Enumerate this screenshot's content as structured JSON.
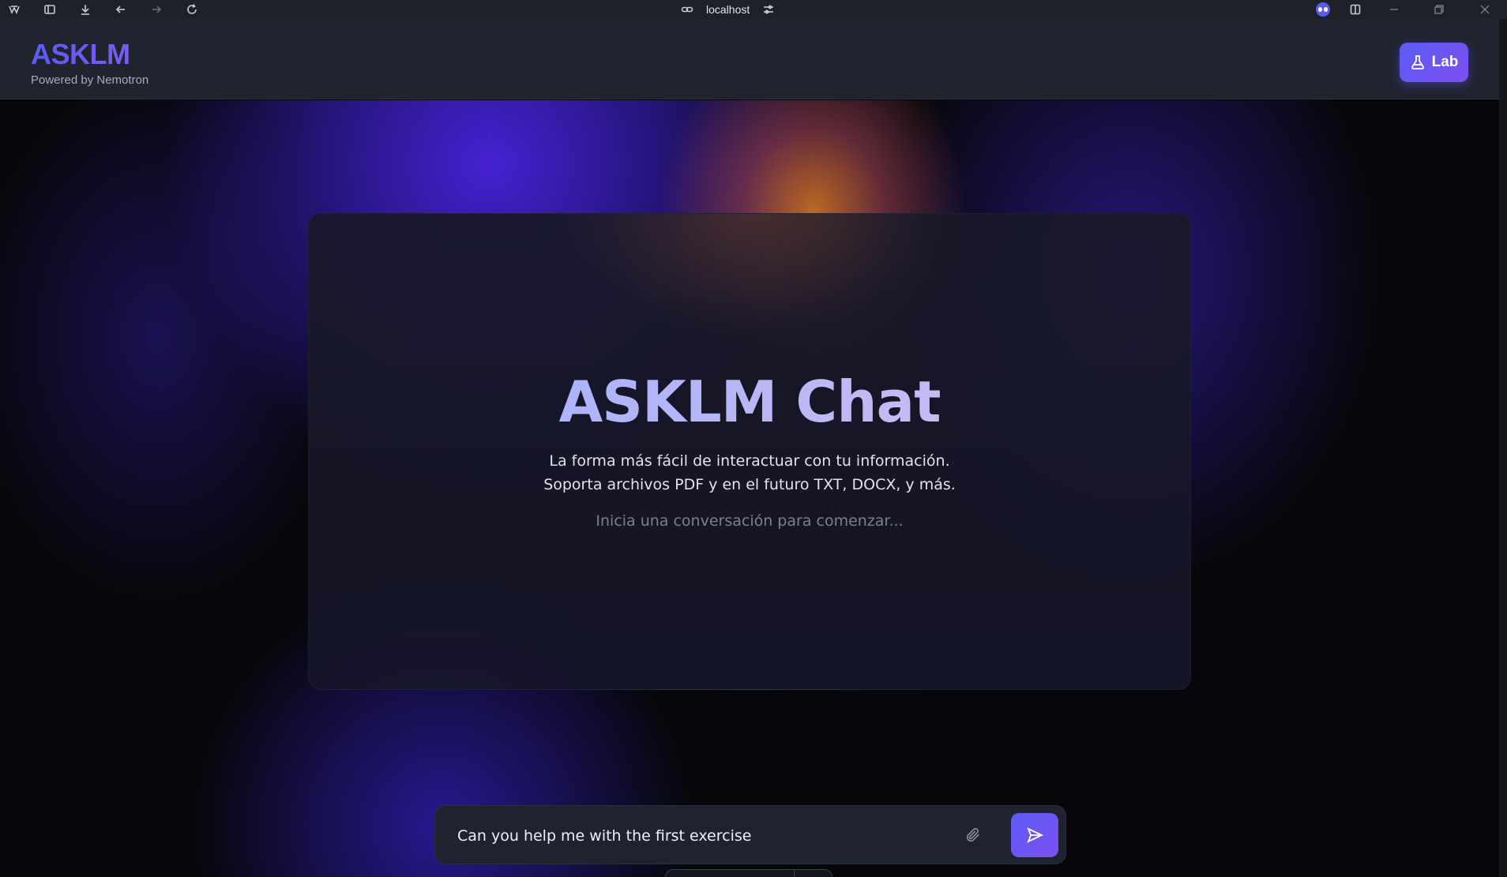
{
  "browser": {
    "url": "localhost",
    "toolbar_icons": [
      "browser-logo-icon",
      "sidebar-toggle-icon",
      "download-icon",
      "back-arrow-icon",
      "forward-arrow-icon",
      "reload-icon"
    ],
    "url_icons": [
      "link-icon",
      "page-settings-icon"
    ],
    "right_icons": [
      "extension-avatar-icon",
      "split-view-icon",
      "minimize-icon",
      "restore-icon",
      "close-icon"
    ]
  },
  "header": {
    "brand": "ASKLM",
    "tagline": "Powered by Nemotron",
    "lab_button": "Lab",
    "lab_icon": "flask-icon"
  },
  "hero": {
    "title": "ASKLM Chat",
    "description_line1": "La forma más fácil de interactuar con tu información.",
    "description_line2": "Soporta archivos PDF y en el futuro TXT, DOCX, y más.",
    "hint": "Inicia una conversación para comenzar..."
  },
  "chat": {
    "input_value": "Can you help me with the first exercise",
    "attach_icon": "paperclip-icon",
    "send_icon": "send-icon"
  },
  "colors": {
    "accent_start": "#5a5cf5",
    "accent_end": "#7e4ef0",
    "header_bg": "#1f242e",
    "card_bg": "#181828"
  }
}
